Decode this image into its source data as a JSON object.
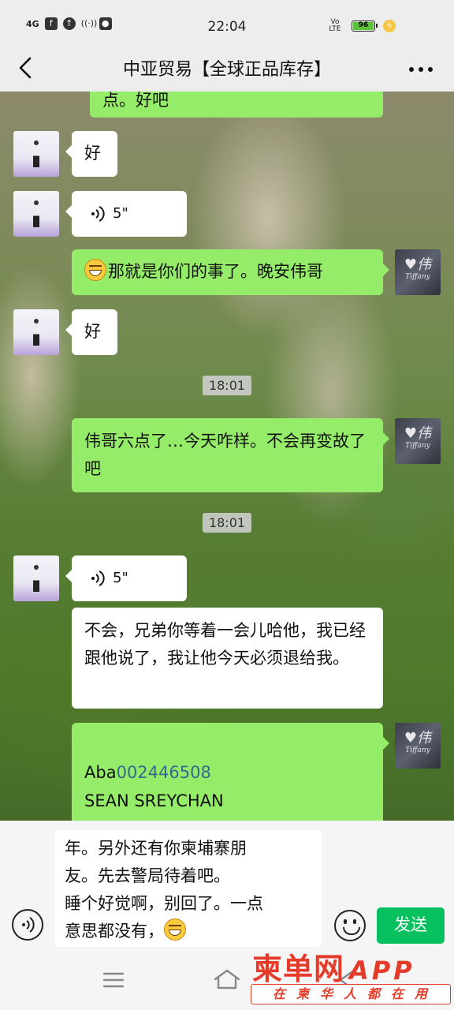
{
  "status_bar": {
    "network": "4G",
    "time": "22:04",
    "volte": "Vo LTE",
    "battery": "96",
    "icons": [
      "signal-icon",
      "facebook-icon",
      "upload-icon",
      "hotspot-icon",
      "microphone-icon",
      "battery-icon",
      "charging-icon"
    ]
  },
  "header": {
    "title": "中亚贸易【全球正品库存】",
    "back_icon": "back-arrow-icon",
    "more_icon": "more-dots-icon"
  },
  "messages": [
    {
      "id": "m0",
      "side": "right",
      "type": "text",
      "text": "点。好吧"
    },
    {
      "id": "m1",
      "side": "left",
      "type": "text",
      "text": "好"
    },
    {
      "id": "m2",
      "side": "left",
      "type": "voice",
      "duration": "5\""
    },
    {
      "id": "m3",
      "side": "right",
      "type": "text",
      "emoji": "grin",
      "text": "那就是你们的事了。晚安伟哥"
    },
    {
      "id": "m4",
      "side": "left",
      "type": "text",
      "text": "好"
    },
    {
      "id": "t1",
      "type": "timestamp",
      "text": "18:01"
    },
    {
      "id": "m5",
      "side": "right",
      "type": "text",
      "text": "伟哥六点了…今天咋样。不会再变故了吧"
    },
    {
      "id": "t2",
      "type": "timestamp",
      "text": "18:01"
    },
    {
      "id": "m6",
      "side": "left",
      "type": "voice",
      "duration": "5\""
    },
    {
      "id": "m7",
      "side": "left",
      "type": "text",
      "text": "不会，兄弟你等着一会儿哈他，我已经跟他说了，我让他今天必须退给我。"
    },
    {
      "id": "m8",
      "side": "right",
      "type": "text",
      "prefix": "Aba",
      "link": "002446508",
      "line2": "SEAN SREYCHAN"
    }
  ],
  "input": {
    "lines": [
      "年。另外还有你柬埔寨朋",
      "友。先去警局待着吧。",
      "睡个好觉啊，别回了。一点",
      "意思都没有，"
    ],
    "trailing_emoji": "grin",
    "send_label": "发送"
  },
  "watermark": {
    "brand": "柬单网",
    "app": "APP",
    "slogan": "在柬华人都在用"
  },
  "colors": {
    "bubble_me": "#95ec69",
    "bubble_other": "#ffffff",
    "send_button": "#07c160",
    "watermark": "#e53b2a",
    "link": "#35698f"
  }
}
